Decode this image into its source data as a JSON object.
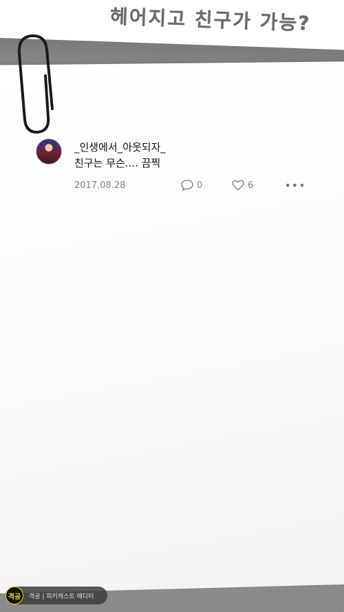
{
  "header": {
    "headline": "헤어지고 친구가 가능?"
  },
  "post": {
    "username": "_인생에서_아웃되자_",
    "content": "친구는 무슨.... 끔찍",
    "date": "2017.08.28",
    "comment_count": "0",
    "like_count": "6",
    "more_label": "•••"
  },
  "footer": {
    "logo_text": "격공",
    "caption": "격공 | 피키캐스트 에디터"
  },
  "icons": {
    "comment": "comment-bubble-icon",
    "like": "heart-icon",
    "more": "more-dots-icon",
    "clip": "paperclip-icon"
  },
  "colors": {
    "meta_text": "#888888",
    "band_gray": "#858585",
    "logo_yellow": "#f7d418"
  }
}
